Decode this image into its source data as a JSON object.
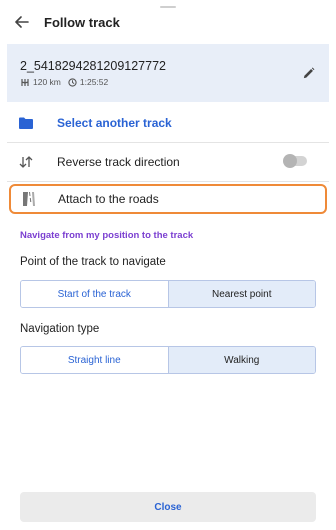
{
  "header": {
    "title": "Follow track",
    "back_icon": "arrow-left-icon"
  },
  "track": {
    "name": "2_5418294281209127772",
    "distance": "120 km",
    "duration": "1:25:52",
    "distance_icon": "route-icon",
    "duration_icon": "clock-icon",
    "edit_icon": "pencil-icon"
  },
  "actions": {
    "select_another": "Select another track",
    "reverse": "Reverse track direction",
    "reverse_enabled": false,
    "attach": "Attach to the roads"
  },
  "navigate_link": "Navigate from my position to the track",
  "point_section": {
    "label": "Point of the track to navigate",
    "options": [
      "Start of the track",
      "Nearest point"
    ],
    "selected": "Nearest point"
  },
  "nav_type_section": {
    "label": "Navigation type",
    "options": [
      "Straight line",
      "Walking"
    ],
    "selected": "Walking"
  },
  "footer": {
    "close_label": "Close"
  },
  "colors": {
    "accent": "#2a63d4",
    "link_purple": "#7b3fd1",
    "highlight": "#ef8a38",
    "card_bg": "#e8eef8"
  }
}
